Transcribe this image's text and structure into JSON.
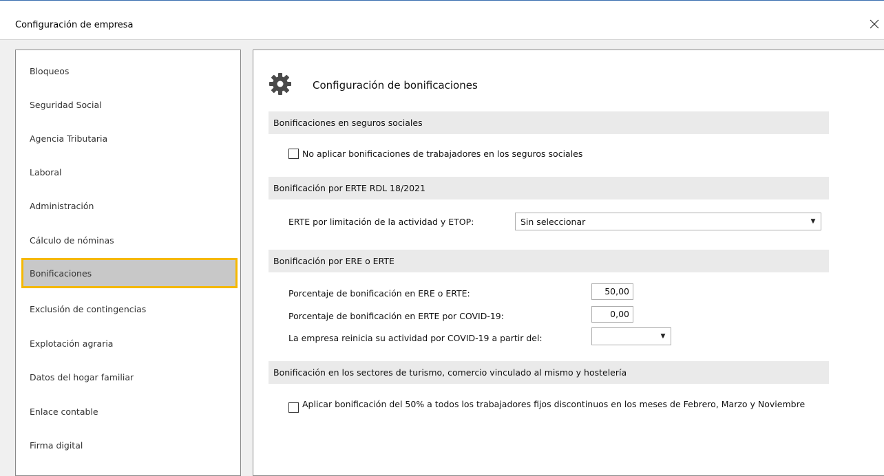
{
  "window": {
    "title": "Configuración de empresa",
    "close_glyph": "×"
  },
  "sidebar": {
    "items": [
      {
        "label": "Bloqueos"
      },
      {
        "label": "Seguridad Social"
      },
      {
        "label": "Agencia Tributaria"
      },
      {
        "label": "Laboral"
      },
      {
        "label": "Administración"
      },
      {
        "label": "Cálculo de nóminas"
      },
      {
        "label": "Bonificaciones",
        "selected": true
      },
      {
        "label": "Exclusión de contingencias"
      },
      {
        "label": "Explotación agraria"
      },
      {
        "label": "Datos del hogar familiar"
      },
      {
        "label": "Enlace contable"
      },
      {
        "label": "Firma digital"
      }
    ]
  },
  "main": {
    "icon": "gear-icon",
    "title": "Configuración de bonificaciones",
    "sections": {
      "seguros": {
        "header": "Bonificaciones en seguros sociales",
        "checkbox_label": "No aplicar bonificaciones de trabajadores en los seguros sociales",
        "checked": false
      },
      "erte_rdl": {
        "header": "Bonificación por ERTE RDL 18/2021",
        "field_label": "ERTE por limitación de la actividad y ETOP:",
        "select_value": "Sin seleccionar"
      },
      "ere": {
        "header": "Bonificación por ERE o ERTE",
        "pct_ere_label": "Porcentaje de bonificación en ERE o ERTE:",
        "pct_ere_value": "50,00",
        "pct_covid_label": "Porcentaje de bonificación en ERTE por COVID-19:",
        "pct_covid_value": "0,00",
        "date_label": "La empresa reinicia su actividad por COVID-19 a partir del:",
        "date_value": ""
      },
      "turismo": {
        "header": "Bonificación en los sectores de turismo, comercio vinculado al mismo y hostelería",
        "checkbox_label": "Aplicar bonificación del 50% a todos los trabajadores fijos discontinuos en los meses de Febrero, Marzo y Noviembre",
        "checked": false
      }
    }
  },
  "colors": {
    "selection_border": "#f5b800",
    "selection_bg": "#c8c8c8",
    "section_bg": "#eaeaea",
    "title_accent": "#3a6fb0"
  }
}
